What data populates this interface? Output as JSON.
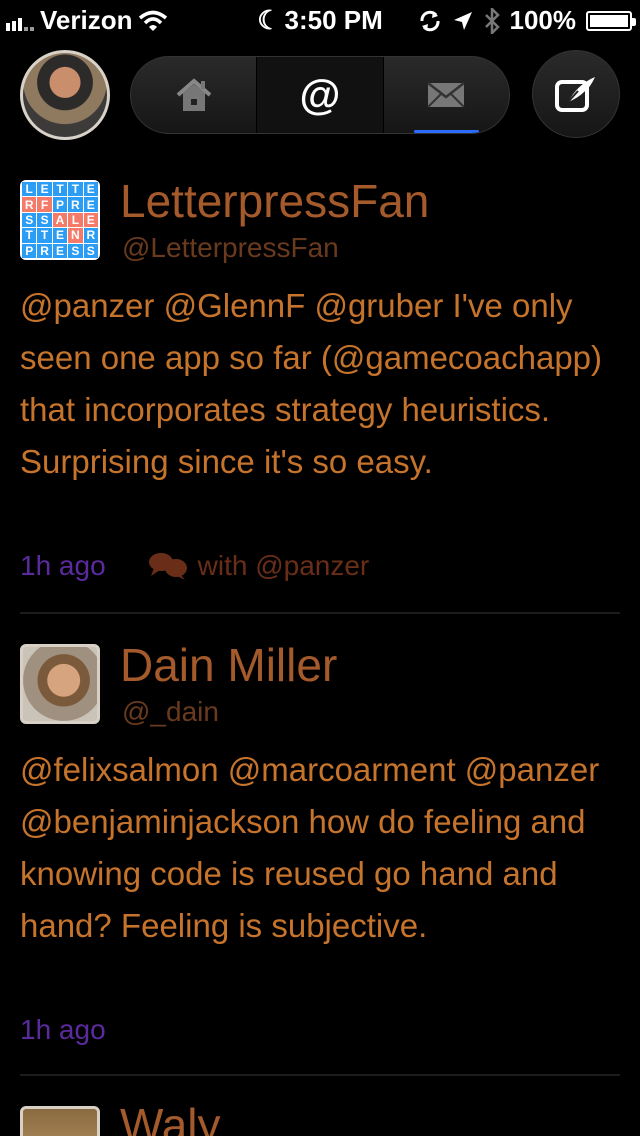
{
  "status_bar": {
    "carrier": "Verizon",
    "time": "3:50 PM",
    "battery": "100%"
  },
  "nav": {
    "tabs": [
      {
        "name": "home",
        "icon": "house-icon"
      },
      {
        "name": "mentions",
        "label": "@"
      },
      {
        "name": "messages",
        "icon": "envelope-icon"
      }
    ],
    "active_tab": "mentions",
    "compose_icon": "compose-icon"
  },
  "colors": {
    "name": "#a45a2a",
    "body": "#c6742c",
    "time": "#5b2a9e",
    "conversation": "#6a2e18"
  },
  "tweets": [
    {
      "name": "LetterpressFan",
      "handle": "@LetterpressFan",
      "text": "@panzer @GlennF @gruber I've only seen one app so far (@gamecoachapp) that incorporates strategy heuristics. Surprising since it's so easy.",
      "time": "1h ago",
      "conversation": "with @panzer",
      "avatar_letters": [
        "L",
        "E",
        "T",
        "T",
        "E",
        "R",
        "F",
        "P",
        "R",
        "E",
        "S",
        "S",
        "A",
        "L",
        "E",
        "T",
        "T",
        "E",
        "N",
        "R",
        "P",
        "R",
        "E",
        "S",
        "S"
      ]
    },
    {
      "name": "Dain Miller",
      "handle": "@_dain",
      "text": "@felixsalmon @marcoarment @panzer @benjaminjackson how do feeling and knowing code is reused go hand and hand?  Feeling is subjective.",
      "time": "1h ago"
    },
    {
      "name": "Waly"
    }
  ]
}
